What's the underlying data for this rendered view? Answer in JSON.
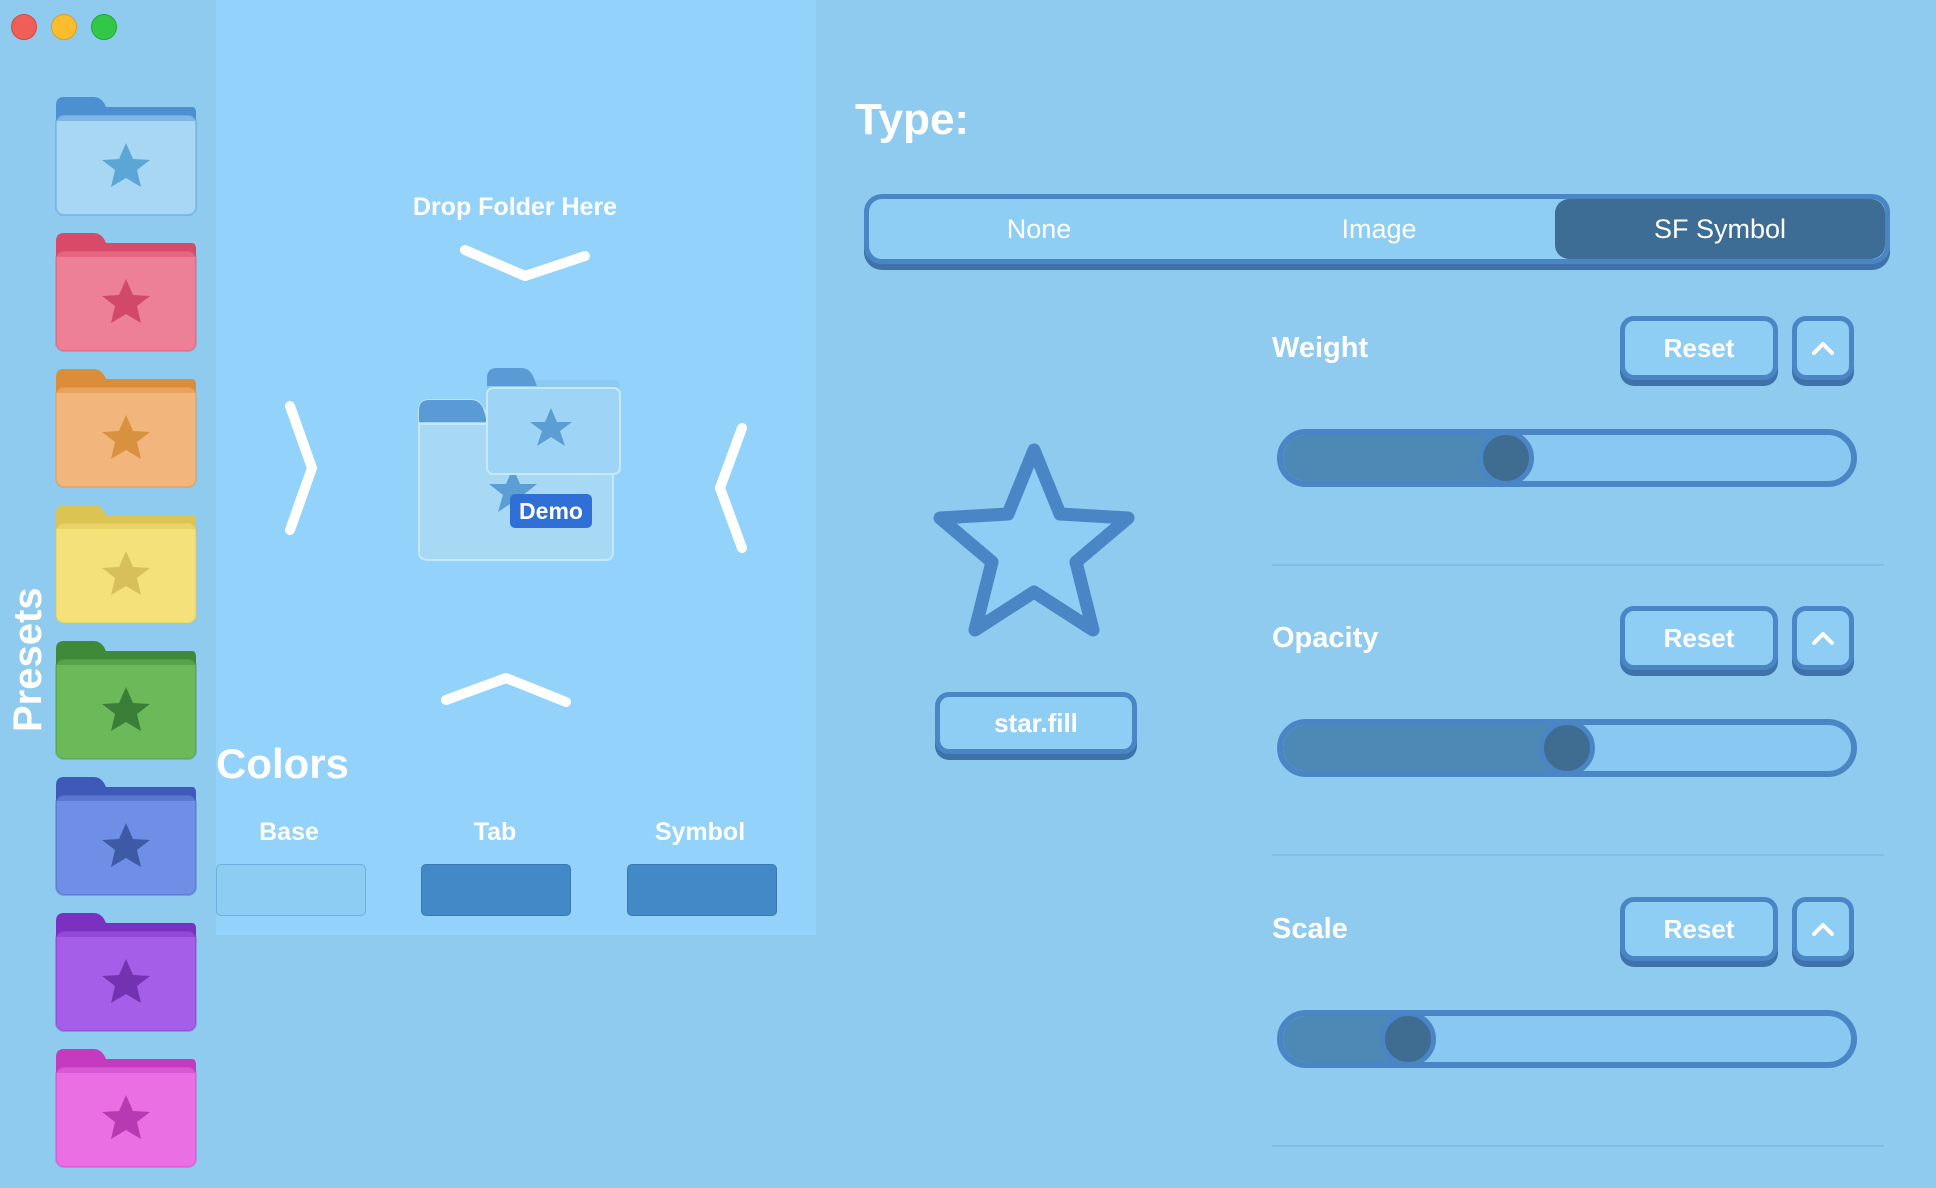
{
  "window": {
    "traffic_lights": [
      "close",
      "minimize",
      "zoom"
    ]
  },
  "presets": {
    "label": "Presets",
    "items": [
      {
        "name": "blue",
        "base": "#a7d7f3",
        "tab": "#4d90d2",
        "symbol": "#5ca6d6"
      },
      {
        "name": "red",
        "base": "#ed7f96",
        "tab": "#d94a69",
        "symbol": "#d14868"
      },
      {
        "name": "orange",
        "base": "#f2b67d",
        "tab": "#dc8d39",
        "symbol": "#d8913f"
      },
      {
        "name": "yellow",
        "base": "#f4e179",
        "tab": "#dcc453",
        "symbol": "#d7c05c"
      },
      {
        "name": "green",
        "base": "#6cb95a",
        "tab": "#3f8a39",
        "symbol": "#3b7e38"
      },
      {
        "name": "indigo",
        "base": "#6f8ee6",
        "tab": "#3e59b8",
        "symbol": "#3f5aa5"
      },
      {
        "name": "purple",
        "base": "#a55ee8",
        "tab": "#7a30c1",
        "symbol": "#7232b1"
      },
      {
        "name": "pink",
        "base": "#ea6fe3",
        "tab": "#c53bc0",
        "symbol": "#b73ab2"
      }
    ]
  },
  "drop": {
    "label": "Drop Folder Here"
  },
  "demo": {
    "badge": "Demo"
  },
  "colors": {
    "title": "Colors",
    "labels": [
      "Base",
      "Tab",
      "Symbol"
    ],
    "values": {
      "base": "#8dccf3",
      "tab": "#4389c8",
      "symbol": "#4389c8"
    }
  },
  "type": {
    "title": "Type:",
    "options": [
      "None",
      "Image",
      "SF Symbol"
    ],
    "selected": "SF Symbol"
  },
  "symbol": {
    "name": "star.fill"
  },
  "controls": [
    {
      "label": "Weight",
      "reset": "Reset",
      "value": 0.38
    },
    {
      "label": "Opacity",
      "reset": "Reset",
      "value": 0.5
    },
    {
      "label": "Scale",
      "reset": "Reset",
      "value": 0.19
    }
  ]
}
